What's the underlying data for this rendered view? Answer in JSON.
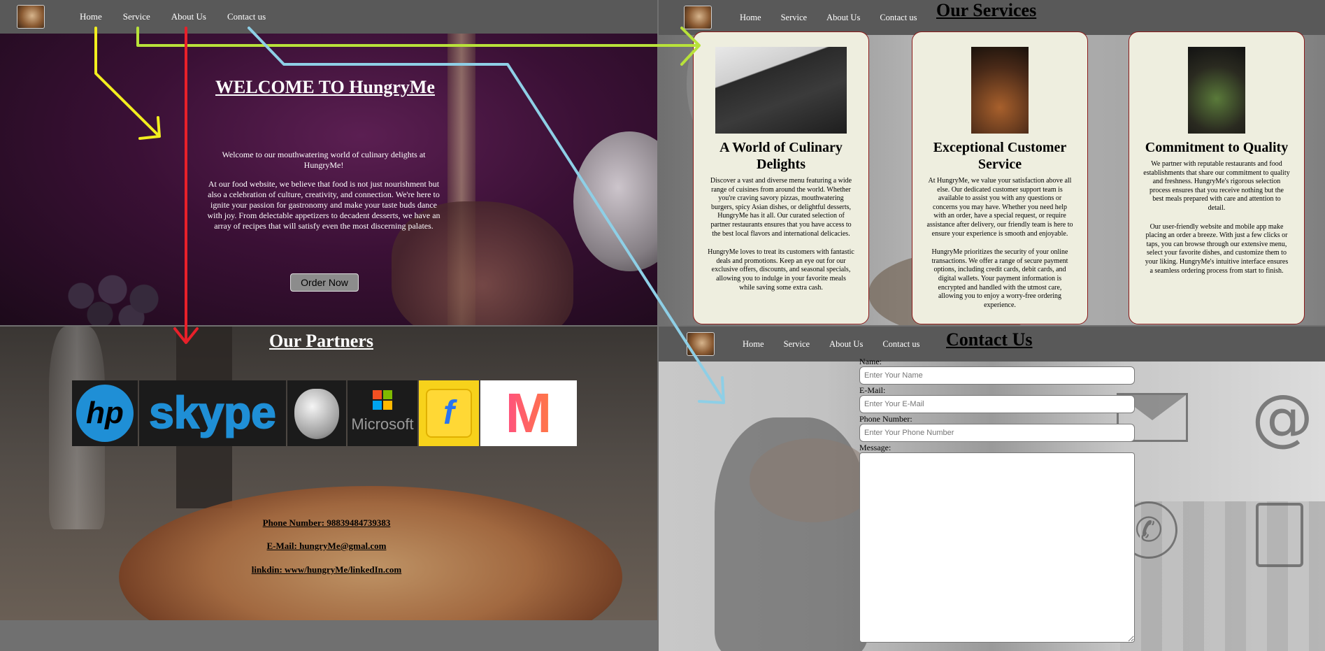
{
  "nav": {
    "home": "Home",
    "service": "Service",
    "about": "About Us",
    "contact": "Contact us"
  },
  "hero": {
    "title": "WELCOME TO HungryMe",
    "paragraph1": "Welcome to our mouthwatering world of culinary delights at HungryMe!",
    "paragraph2": "At our food website, we believe that food is not just nourishment but also a celebration of culture, creativity, and connection. We're here to ignite your passion for gastronomy and make your taste buds dance with joy. From delectable appetizers to decadent desserts, we have an array of recipes that will satisfy even the most discerning palates.",
    "cta": "Order Now"
  },
  "services": {
    "title": "Our Services",
    "cards": [
      {
        "heading": "A World of Culinary Delights",
        "p1": "Discover a vast and diverse menu featuring a wide range of cuisines from around the world. Whether you're craving savory pizzas, mouthwatering burgers, spicy Asian dishes, or delightful desserts, HungryMe has it all. Our curated selection of partner restaurants ensures that you have access to the best local flavors and international delicacies.",
        "p2": "HungryMe loves to treat its customers with fantastic deals and promotions. Keep an eye out for our exclusive offers, discounts, and seasonal specials, allowing you to indulge in your favorite meals while saving some extra cash."
      },
      {
        "heading": "Exceptional Customer Service",
        "p1": "At HungryMe, we value your satisfaction above all else. Our dedicated customer support team is available to assist you with any questions or concerns you may have. Whether you need help with an order, have a special request, or require assistance after delivery, our friendly team is here to ensure your experience is smooth and enjoyable.",
        "p2": "HungryMe prioritizes the security of your online transactions. We offer a range of secure payment options, including credit cards, debit cards, and digital wallets. Your payment information is encrypted and handled with the utmost care, allowing you to enjoy a worry-free ordering experience."
      },
      {
        "heading": "Commitment to Quality",
        "p1": "We partner with reputable restaurants and food establishments that share our commitment to quality and freshness. HungryMe's rigorous selection process ensures that you receive nothing but the best meals prepared with care and attention to detail.",
        "p2": "Our user-friendly website and mobile app make placing an order a breeze. With just a few clicks or taps, you can browse through our extensive menu, select your favorite dishes, and customize them to your liking. HungryMe's intuitive interface ensures a seamless ordering process from start to finish."
      }
    ]
  },
  "partners": {
    "title": "Our Partners",
    "logos": {
      "hp": "hp",
      "skype": "skype",
      "microsoft": "Microsoft",
      "flipkart": "f",
      "myntra": "M"
    },
    "phone": "Phone Number: 98839484739383",
    "email": "E-Mail: hungryMe@gmal.com",
    "linkedin": "linkdin: www/hungryMe/linkedIn.com"
  },
  "contact": {
    "title": "Contact Us",
    "name_label": "Name:",
    "name_placeholder": "Enter Your Name",
    "email_label": "E-Mail:",
    "email_placeholder": "Enter Your E-Mail",
    "phone_label": "Phone Number:",
    "phone_placeholder": "Enter Your Phone Number",
    "message_label": "Message:",
    "at_symbol": "@",
    "phone_glyph": "✆"
  },
  "arrow_colors": {
    "home": "#f2ee1f",
    "service": "#b8e23a",
    "about": "#e8202a",
    "contact": "#8ecfe6"
  }
}
